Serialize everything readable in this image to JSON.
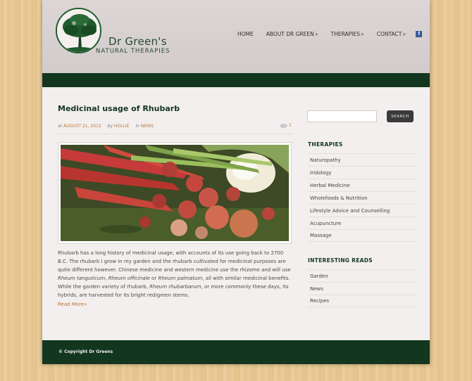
{
  "brand": {
    "name": "Dr Green's",
    "tagline": "NATURAL THERAPIES"
  },
  "nav": {
    "items": [
      {
        "label": "HOME",
        "has_submenu": false
      },
      {
        "label": "ABOUT DR GREEN",
        "has_submenu": true
      },
      {
        "label": "THERAPIES",
        "has_submenu": true
      },
      {
        "label": "CONTACT",
        "has_submenu": true
      }
    ],
    "submenu_arrow": "»",
    "facebook_glyph": "f"
  },
  "post": {
    "title": "Medicinal usage of Rhubarb",
    "meta": {
      "at_label": "at",
      "date": "AUGUST 21, 2012",
      "by_label": "by",
      "author": "HOLLIE",
      "in_label": "in",
      "category": "NEWS",
      "comment_count": "1"
    },
    "image_alt": "Rhubarb stalks, radishes and onions",
    "body": {
      "p1": "Rhubarb has a long history of medicinal usage, with accounts of its use going back to 2700 B.C. The rhubarb I grow in my garden and the rhubarb cultivated for medicinal purposes are quite different however. Chinese medicine and western medicine use the rhizome and will use ",
      "em1": "Rheum tanguticum",
      "t2": ", ",
      "em2": "Rheum officinale",
      "t3": " or ",
      "em3": "Rheum palmatum",
      "t4": ", all with similar medicinal benefits. While the garden variety of rhubarb, ",
      "em4": "Rheum rhubarbarum",
      "t5": ", or more commonly these days, its hybrids, are harvested for its bright red/green stems."
    },
    "read_more": "Read More",
    "read_more_arrow": "»"
  },
  "sidebar": {
    "search_placeholder": "",
    "search_button": "SEARCH",
    "therapies": {
      "title": "THERAPIES",
      "items": [
        "Naturopathy",
        "Iridology",
        "Herbal Medicine",
        "Wholefoods & Nutrition",
        "Lifestyle Advice and Counselling",
        "Acupuncture",
        "Massage"
      ]
    },
    "reads": {
      "title": "INTERESTING READS",
      "items": [
        "Garden",
        "News",
        "Recipes"
      ]
    }
  },
  "footer": {
    "copyright": "© Copyright Dr Greens"
  },
  "colors": {
    "dark_green": "#13361f",
    "accent_orange": "#b97432",
    "content_bg": "#f3efee"
  },
  "icons": [
    "tree-logo-icon",
    "facebook-icon",
    "comment-icon"
  ]
}
